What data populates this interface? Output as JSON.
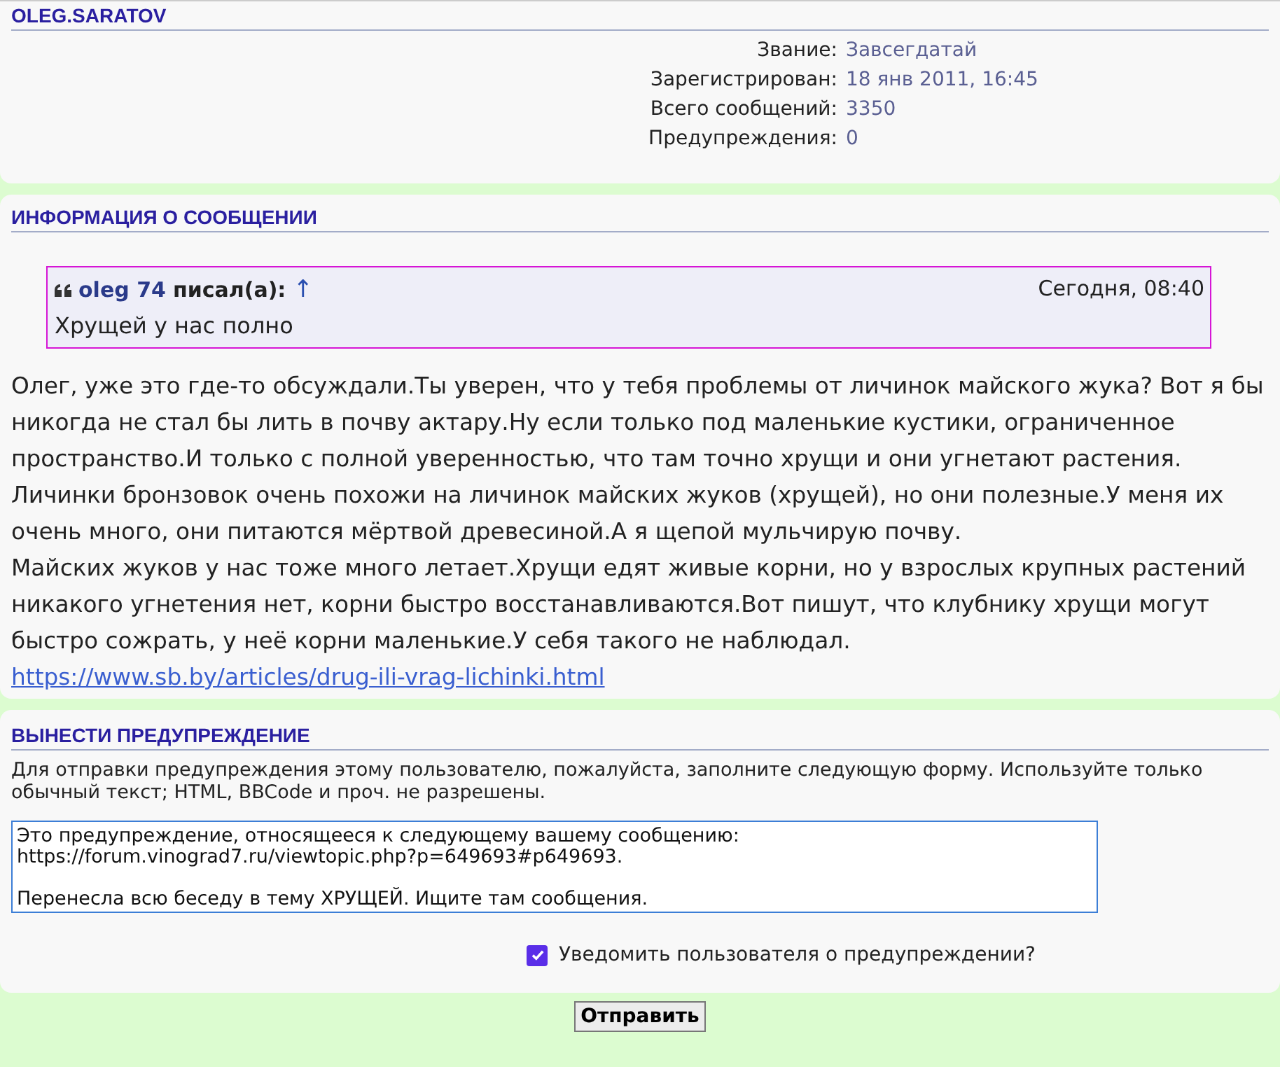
{
  "profile": {
    "title": "OLEG.SARATOV",
    "fields": [
      {
        "label": "Звание:",
        "value": "Завсегдатай"
      },
      {
        "label": "Зарегистрирован:",
        "value": "18 янв 2011, 16:45"
      },
      {
        "label": "Всего сообщений:",
        "value": "3350"
      },
      {
        "label": "Предупреждения:",
        "value": "0"
      }
    ]
  },
  "post": {
    "title": "ИНФОРМАЦИЯ О СООБЩЕНИИ",
    "quote": {
      "author": "oleg 74",
      "wrote": "писал(а):",
      "jump": "↑",
      "date": "Сегодня, 08:40",
      "text": "Хрущей у нас полно"
    },
    "paragraphs": [
      "Олег, уже это где-то обсуждали.Ты уверен, что у тебя проблемы от личинок майского жука? Вот я бы никогда не стал бы лить в почву актару.Ну если только под маленькие кустики, ограниченное пространство.И только с полной уверенностью, что там точно хрущи и они угнетают растения. Личинки бронзовок очень похожи на личинок майских жуков (хрущей), но они полезные.У меня их очень много, они питаются мёртвой древесиной.А я щепой мульчирую почву.",
      "Майских жуков у нас тоже много летает.Хрущи едят живые корни, но у взрослых крупных растений никакого угнетения нет, корни быстро восстанавливаются.Вот пишут, что клубнику хрущи могут быстро сожрать, у неё корни маленькие.У себя такого не наблюдал."
    ],
    "link": "https://www.sb.by/articles/drug-ili-vrag-lichinki.html"
  },
  "warn": {
    "title": "ВЫНЕСТИ ПРЕДУПРЕЖДЕНИЕ",
    "intro": "Для отправки предупреждения этому пользователю, пожалуйста, заполните следующую форму. Используйте только обычный текст; HTML, BBCode и проч. не разрешены.",
    "message": "Это предупреждение, относящееся к следующему вашему сообщению:\nhttps://forum.vinograd7.ru/viewtopic.php?p=649693#p649693.\n\nПеренесла всю беседу в тему ХРУЩЕЙ. Ищите там сообщения.",
    "notify": {
      "label": "Уведомить пользователя о предупреждении?",
      "checked": true
    },
    "submit": "Отправить"
  }
}
